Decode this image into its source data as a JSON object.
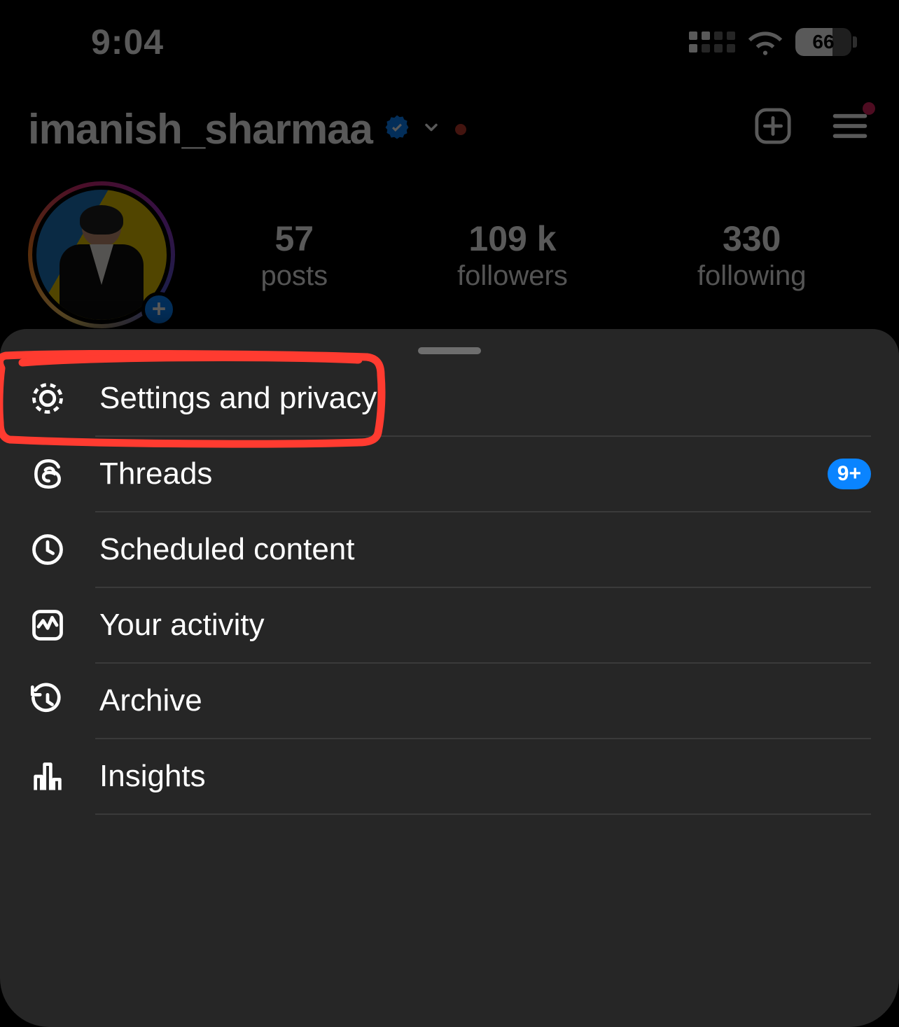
{
  "status_bar": {
    "time": "9:04",
    "battery_percent": "66"
  },
  "header": {
    "username": "imanish_sharmaa"
  },
  "stats": {
    "posts_count": "57",
    "posts_label": "posts",
    "followers_count": "109 k",
    "followers_label": "followers",
    "following_count": "330",
    "following_label": "following"
  },
  "menu": {
    "items": [
      {
        "icon": "gear-icon",
        "label": "Settings and privacy",
        "badge": null
      },
      {
        "icon": "threads-icon",
        "label": "Threads",
        "badge": "9+"
      },
      {
        "icon": "clock-icon",
        "label": "Scheduled content",
        "badge": null
      },
      {
        "icon": "activity-icon",
        "label": "Your activity",
        "badge": null
      },
      {
        "icon": "archive-icon",
        "label": "Archive",
        "badge": null
      },
      {
        "icon": "insights-icon",
        "label": "Insights",
        "badge": null
      }
    ]
  }
}
